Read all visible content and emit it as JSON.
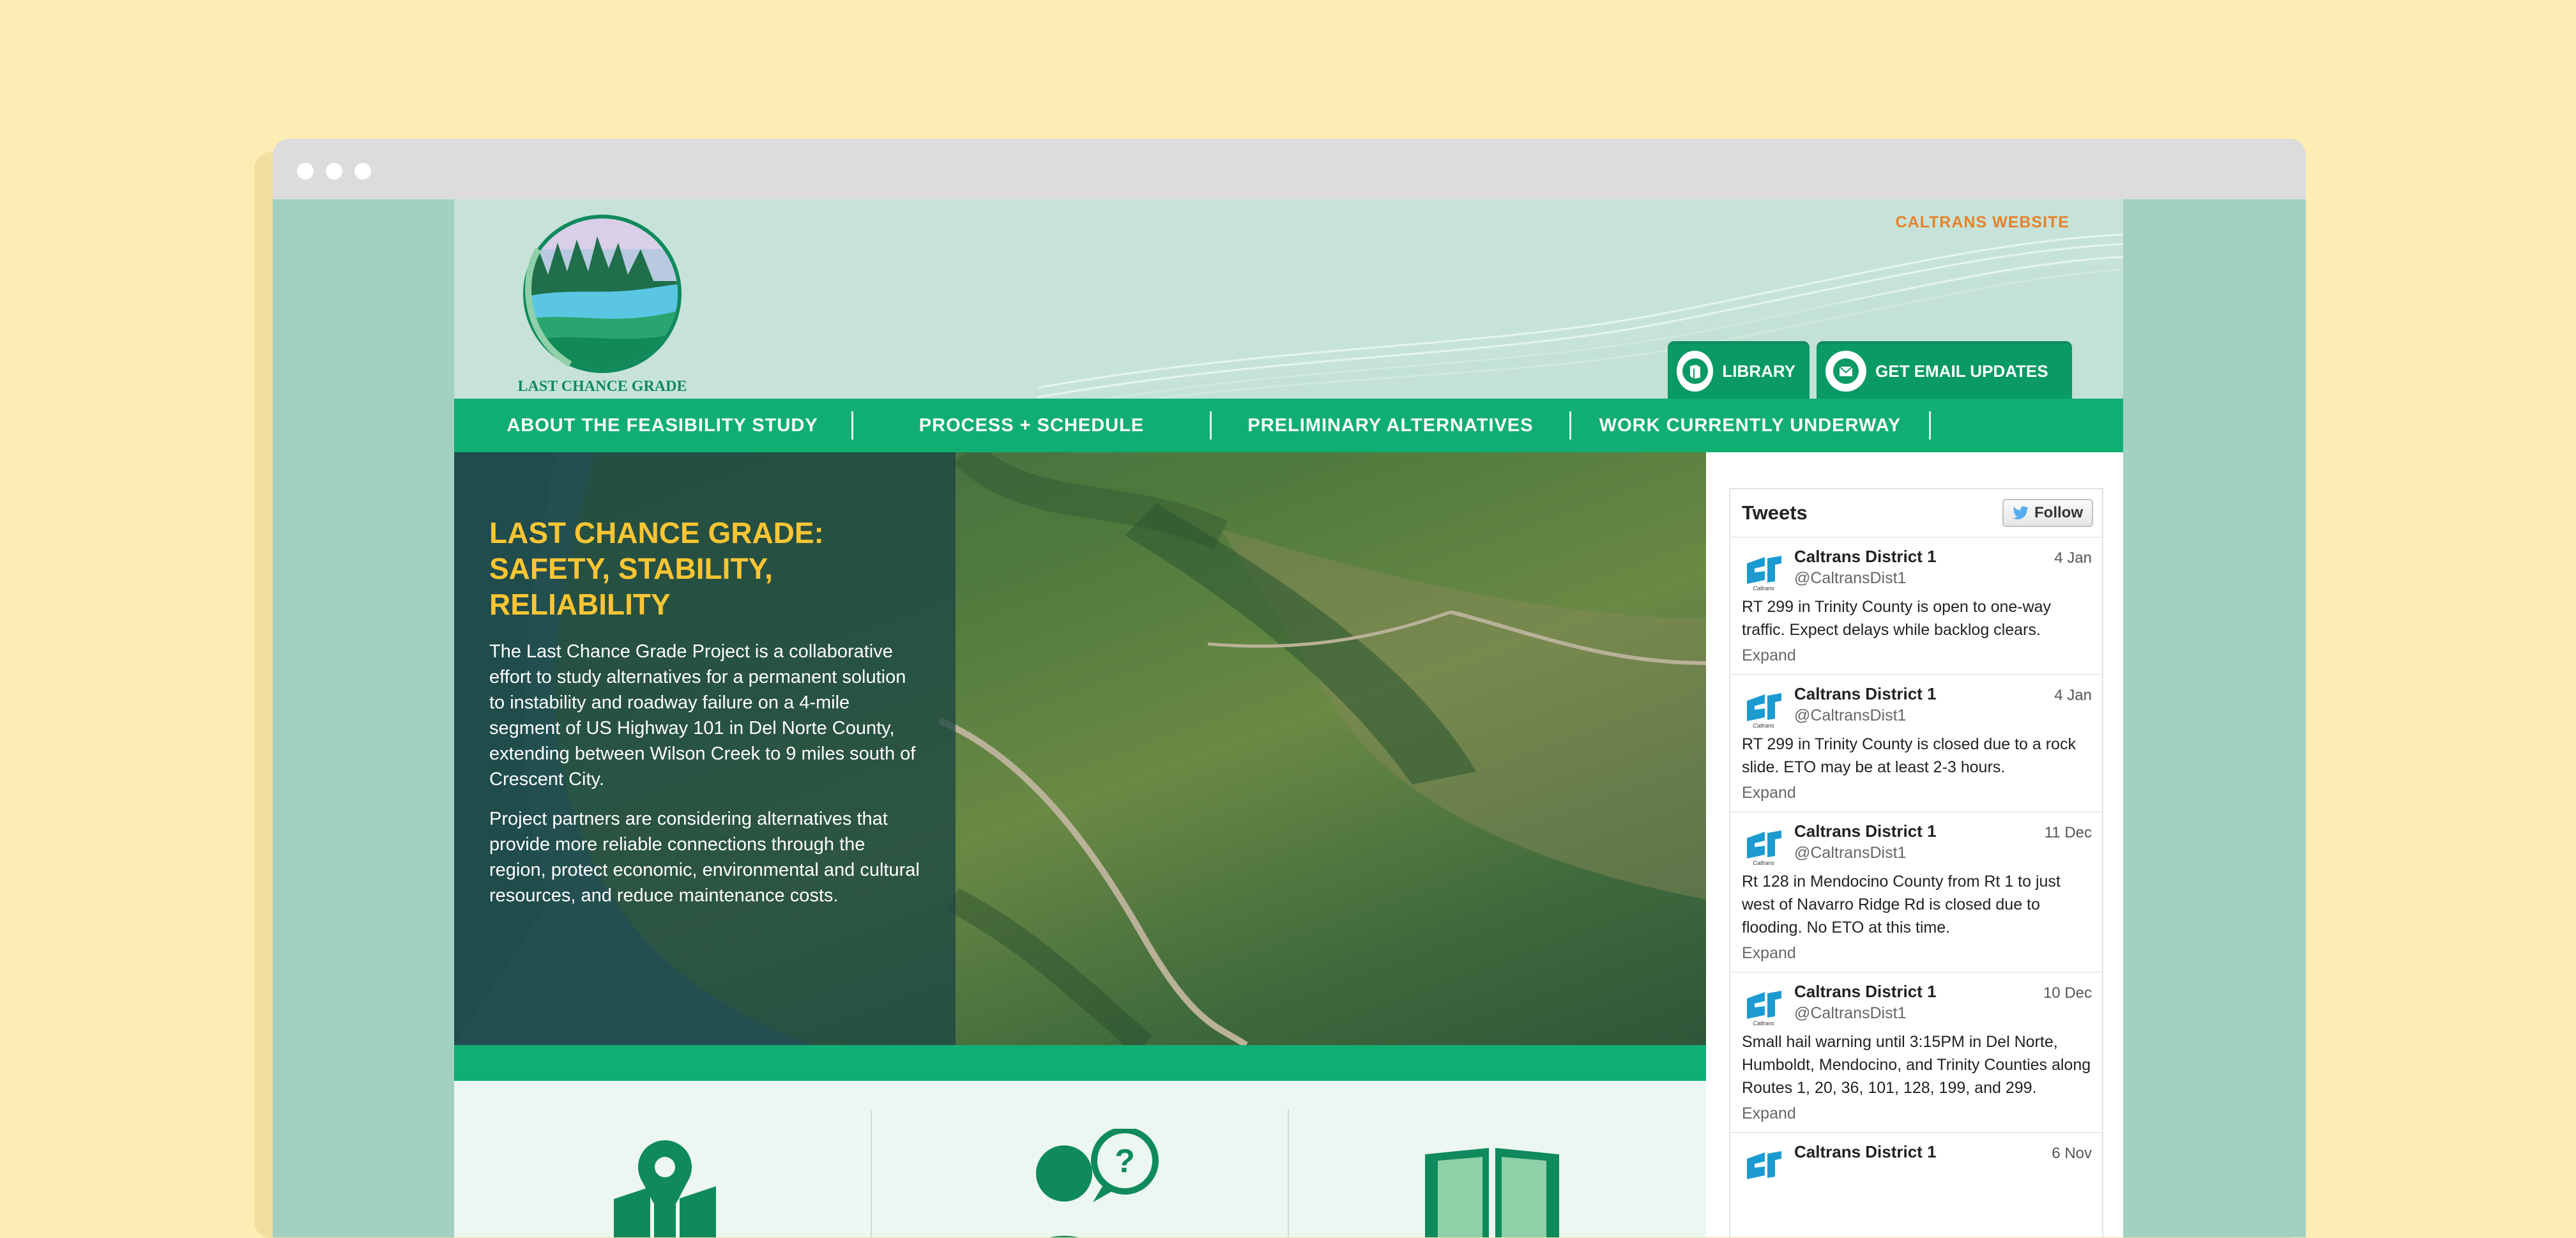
{
  "header": {
    "caltrans_link": "CALTRANS WEBSITE",
    "library_label": "LIBRARY",
    "email_label": "GET EMAIL UPDATES",
    "logo_text": "LAST CHANCE GRADE"
  },
  "nav": {
    "items": [
      {
        "label": "ABOUT THE FEASIBILITY STUDY"
      },
      {
        "label": "PROCESS + SCHEDULE"
      },
      {
        "label": "PRELIMINARY ALTERNATIVES"
      },
      {
        "label": "WORK CURRENTLY UNDERWAY"
      }
    ]
  },
  "hero": {
    "title": "LAST CHANCE GRADE: SAFETY, STABILITY, RELIABILITY",
    "paragraph1": "The Last Chance Grade Project is a collaborative effort to study alternatives for a permanent solution to instability and roadway failure on a 4-mile segment of US Highway 101 in Del Norte County, extending between Wilson Creek to 9 miles south of Crescent City.",
    "paragraph2": "Project partners are considering alternatives that provide more reliable connections through the region, protect economic, environmental and cultural resources, and reduce maintenance costs."
  },
  "features": {
    "icons": [
      "map-pin-icon",
      "person-question-icon",
      "open-book-icon"
    ]
  },
  "twitter": {
    "title": "Tweets",
    "follow_label": "Follow",
    "tweets": [
      {
        "name": "Caltrans District 1",
        "handle": "@CaltransDist1",
        "date": "4 Jan",
        "text": "RT 299 in Trinity County is open to one-way traffic. Expect delays while backlog clears.",
        "expand": "Expand"
      },
      {
        "name": "Caltrans District 1",
        "handle": "@CaltransDist1",
        "date": "4 Jan",
        "text": "RT 299 in Trinity County is closed due to a rock slide. ETO may be at least 2-3 hours.",
        "expand": "Expand"
      },
      {
        "name": "Caltrans District 1",
        "handle": "@CaltransDist1",
        "date": "11 Dec",
        "text": "Rt 128 in Mendocino County from Rt 1 to just west of Navarro Ridge Rd is closed due to flooding.  No ETO at this time.",
        "expand": "Expand"
      },
      {
        "name": "Caltrans District 1",
        "handle": "@CaltransDist1",
        "date": "10 Dec",
        "text": "Small hail warning until 3:15PM in Del Norte, Humboldt, Mendocino, and Trinity Counties along Routes 1, 20, 36, 101, 128, 199, and 299.",
        "expand": "Expand"
      },
      {
        "name": "Caltrans District 1",
        "date": "6 Nov"
      }
    ]
  },
  "colors": {
    "background": "#fdedb5",
    "nav_green": "#11ae74",
    "header_mint": "#c7e3d9",
    "accent_orange": "#e4822d",
    "hero_title_yellow": "#ffc533"
  }
}
